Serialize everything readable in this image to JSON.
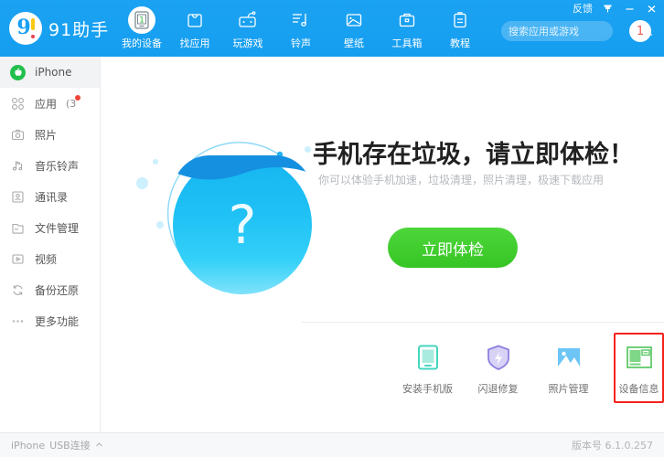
{
  "app": {
    "brand": "91助手",
    "logo_char": "9"
  },
  "titlebar": {
    "feedback_label": "反馈",
    "menu_icon": "pin-icon",
    "minimize_icon": "minimize-icon",
    "close_icon": "close-icon"
  },
  "nav": {
    "items": [
      {
        "label": "我的设备",
        "icon": "device-phone-icon",
        "active": true
      },
      {
        "label": "找应用",
        "icon": "app-bag-icon",
        "active": false
      },
      {
        "label": "玩游戏",
        "icon": "gamepad-icon",
        "active": false
      },
      {
        "label": "铃声",
        "icon": "music-note-icon",
        "active": false
      },
      {
        "label": "壁纸",
        "icon": "wallpaper-image-icon",
        "active": false
      },
      {
        "label": "工具箱",
        "icon": "toolbox-icon",
        "active": false
      },
      {
        "label": "教程",
        "icon": "clipboard-icon",
        "active": false
      }
    ]
  },
  "search": {
    "placeholder": "搜索应用或游戏",
    "value": "",
    "icon": "search-icon"
  },
  "account": {
    "avatar_label": "1"
  },
  "sidebar": {
    "items": [
      {
        "label": "iPhone",
        "icon": "apple-logo-icon",
        "selected": true,
        "count": "",
        "badge": false
      },
      {
        "label": "应用",
        "icon": "apps-grid-icon",
        "selected": false,
        "count": "(3",
        "badge": true
      },
      {
        "label": "照片",
        "icon": "camera-icon",
        "selected": false,
        "count": "",
        "badge": false
      },
      {
        "label": "音乐铃声",
        "icon": "music-note-icon",
        "selected": false,
        "count": "",
        "badge": false
      },
      {
        "label": "通讯录",
        "icon": "contacts-icon",
        "selected": false,
        "count": "",
        "badge": false
      },
      {
        "label": "文件管理",
        "icon": "folder-icon",
        "selected": false,
        "count": "",
        "badge": false
      },
      {
        "label": "视频",
        "icon": "video-play-icon",
        "selected": false,
        "count": "",
        "badge": false
      },
      {
        "label": "备份还原",
        "icon": "refresh-restore-icon",
        "selected": false,
        "count": "",
        "badge": false
      },
      {
        "label": "更多功能",
        "icon": "more-dots-icon",
        "selected": false,
        "count": "",
        "badge": false
      }
    ]
  },
  "main": {
    "headline": "手机存在垃圾，请立即体检！",
    "subline": "你可以体验手机加速，垃圾清理，照片清理，极速下载应用",
    "cta_label": "立即体检",
    "illustration": {
      "icon": "blue-sphere-question-icon",
      "glyph": "?"
    },
    "shortcuts": [
      {
        "label": "安装手机版",
        "icon": "install-phone-icon",
        "highlight": false
      },
      {
        "label": "闪退修复",
        "icon": "shield-bolt-icon",
        "highlight": false
      },
      {
        "label": "照片管理",
        "icon": "photo-mountain-icon",
        "highlight": false
      },
      {
        "label": "设备信息",
        "icon": "device-info-icon",
        "highlight": true
      }
    ]
  },
  "statusbar": {
    "device": "iPhone",
    "connection": "USB连接",
    "chevron": "chevron-up-icon",
    "version": "版本号 6.1.0.257"
  },
  "colors": {
    "brand_blue": "#1aa0f0",
    "cta_green": "#3ecf2c",
    "highlight_red": "#f5221c",
    "badge_red": "#f0453a",
    "apple_green": "#21c04d"
  }
}
